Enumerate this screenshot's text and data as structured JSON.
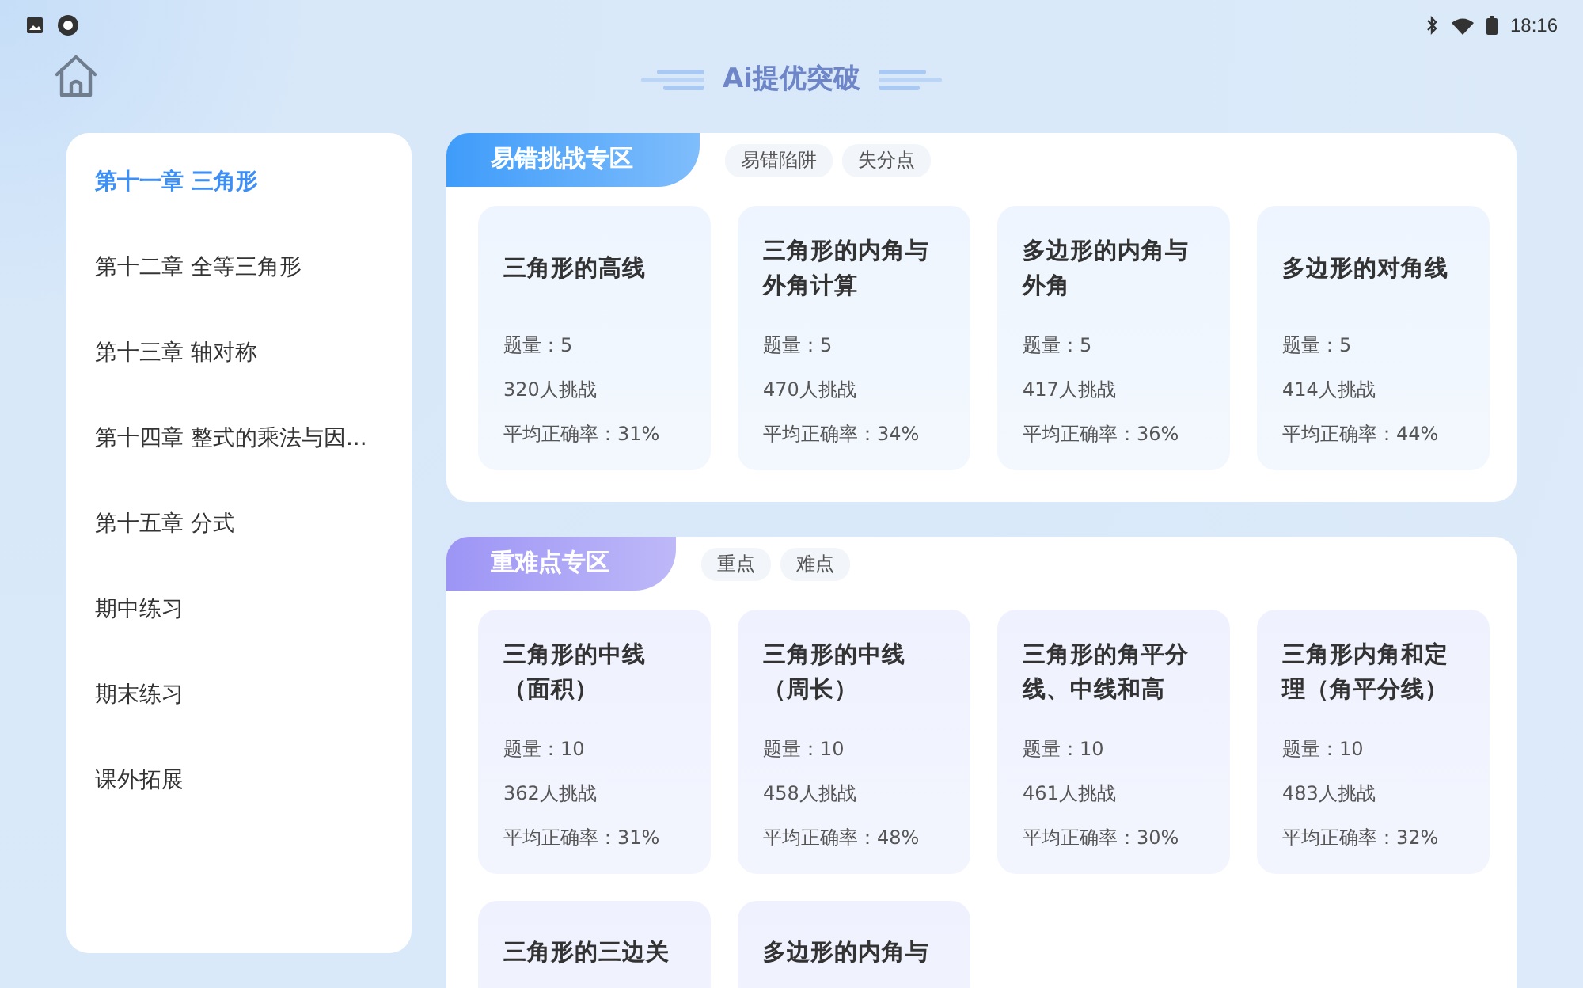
{
  "status_bar": {
    "time": "18:16"
  },
  "header": {
    "title": "Ai提优突破"
  },
  "sidebar": {
    "items": [
      {
        "label": "第十一章 三角形",
        "selected": true
      },
      {
        "label": "第十二章 全等三角形",
        "selected": false
      },
      {
        "label": "第十三章 轴对称",
        "selected": false
      },
      {
        "label": "第十四章 整式的乘法与因...",
        "selected": false
      },
      {
        "label": "第十五章 分式",
        "selected": false
      },
      {
        "label": "期中练习",
        "selected": false
      },
      {
        "label": "期末练习",
        "selected": false
      },
      {
        "label": "课外拓展",
        "selected": false
      }
    ]
  },
  "sections": [
    {
      "title": "易错挑战专区",
      "color": "#3f9cfa",
      "tags": [
        "易错陷阱",
        "失分点"
      ],
      "cards": [
        {
          "title": "三角形的高线",
          "count": "题量：5",
          "challengers": "320人挑战",
          "accuracy": "平均正确率：31%"
        },
        {
          "title": "三角形的内角与外角计算",
          "count": "题量：5",
          "challengers": "470人挑战",
          "accuracy": "平均正确率：34%"
        },
        {
          "title": "多边形的内角与外角",
          "count": "题量：5",
          "challengers": "417人挑战",
          "accuracy": "平均正确率：36%"
        },
        {
          "title": "多边形的对角线",
          "count": "题量：5",
          "challengers": "414人挑战",
          "accuracy": "平均正确率：44%"
        }
      ]
    },
    {
      "title": "重难点专区",
      "color": "#9d95f5",
      "tags": [
        "重点",
        "难点"
      ],
      "cards": [
        {
          "title": "三角形的中线（面积）",
          "count": "题量：10",
          "challengers": "362人挑战",
          "accuracy": "平均正确率：31%"
        },
        {
          "title": "三角形的中线（周长）",
          "count": "题量：10",
          "challengers": "458人挑战",
          "accuracy": "平均正确率：48%"
        },
        {
          "title": "三角形的角平分线、中线和高",
          "count": "题量：10",
          "challengers": "461人挑战",
          "accuracy": "平均正确率：30%"
        },
        {
          "title": "三角形内角和定理（角平分线）",
          "count": "题量：10",
          "challengers": "483人挑战",
          "accuracy": "平均正确率：32%"
        },
        {
          "title": "三角形的三边关"
        },
        {
          "title": "多边形的内角与"
        }
      ]
    }
  ]
}
